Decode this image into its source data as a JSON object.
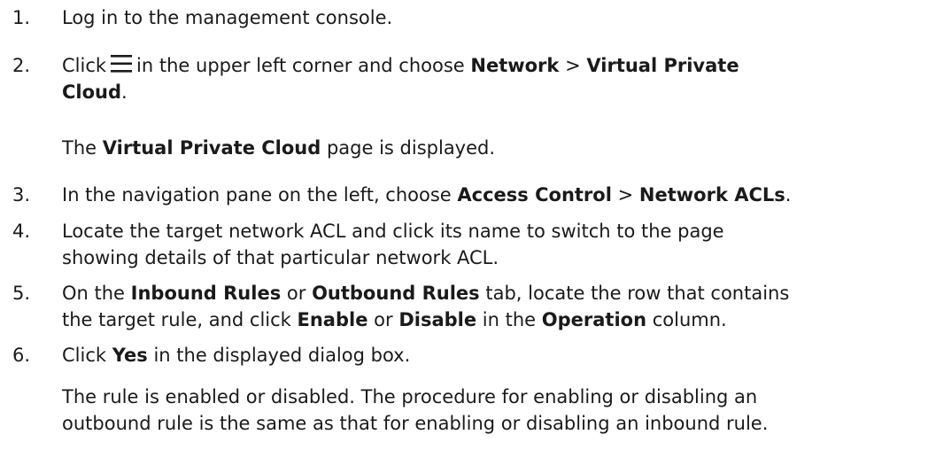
{
  "steps": [
    {
      "number": "1.",
      "text": "Log in to the management console."
    },
    {
      "number": "2.",
      "click": "Click",
      "icon": "menu-icon",
      "mid": "in the upper left corner and choose",
      "network": "Network",
      "sep": ">",
      "vpc_a": "Virtual Private",
      "vpc_b": "Cloud",
      "end": ".",
      "result_pre": "The",
      "result_bold": "Virtual Private Cloud",
      "result_post": "page is displayed."
    },
    {
      "number": "3.",
      "pre": "In the navigation pane on the left, choose",
      "access": "Access Control",
      "sep": ">",
      "acls": "Network ACLs",
      "end": "."
    },
    {
      "number": "4.",
      "line1": "Locate the target network ACL and click its name to switch to the page",
      "line2": "showing details of that particular network ACL."
    },
    {
      "number": "5.",
      "on": "On the",
      "inbound": "Inbound Rules",
      "or1": "or",
      "outbound": "Outbound Rules",
      "tab_text": "tab, locate the row that contains",
      "line2_pre": "the target rule, and click",
      "enable": "Enable",
      "or2": "or",
      "disable": "Disable",
      "in_the": "in the",
      "operation": "Operation",
      "column": "column."
    },
    {
      "number": "6.",
      "click": "Click",
      "yes": "Yes",
      "rest": "in the displayed dialog box.",
      "result_line1": "The rule is enabled or disabled. The procedure for enabling or disabling an",
      "result_line2": "outbound rule is the same as that for enabling or disabling an inbound rule."
    }
  ]
}
